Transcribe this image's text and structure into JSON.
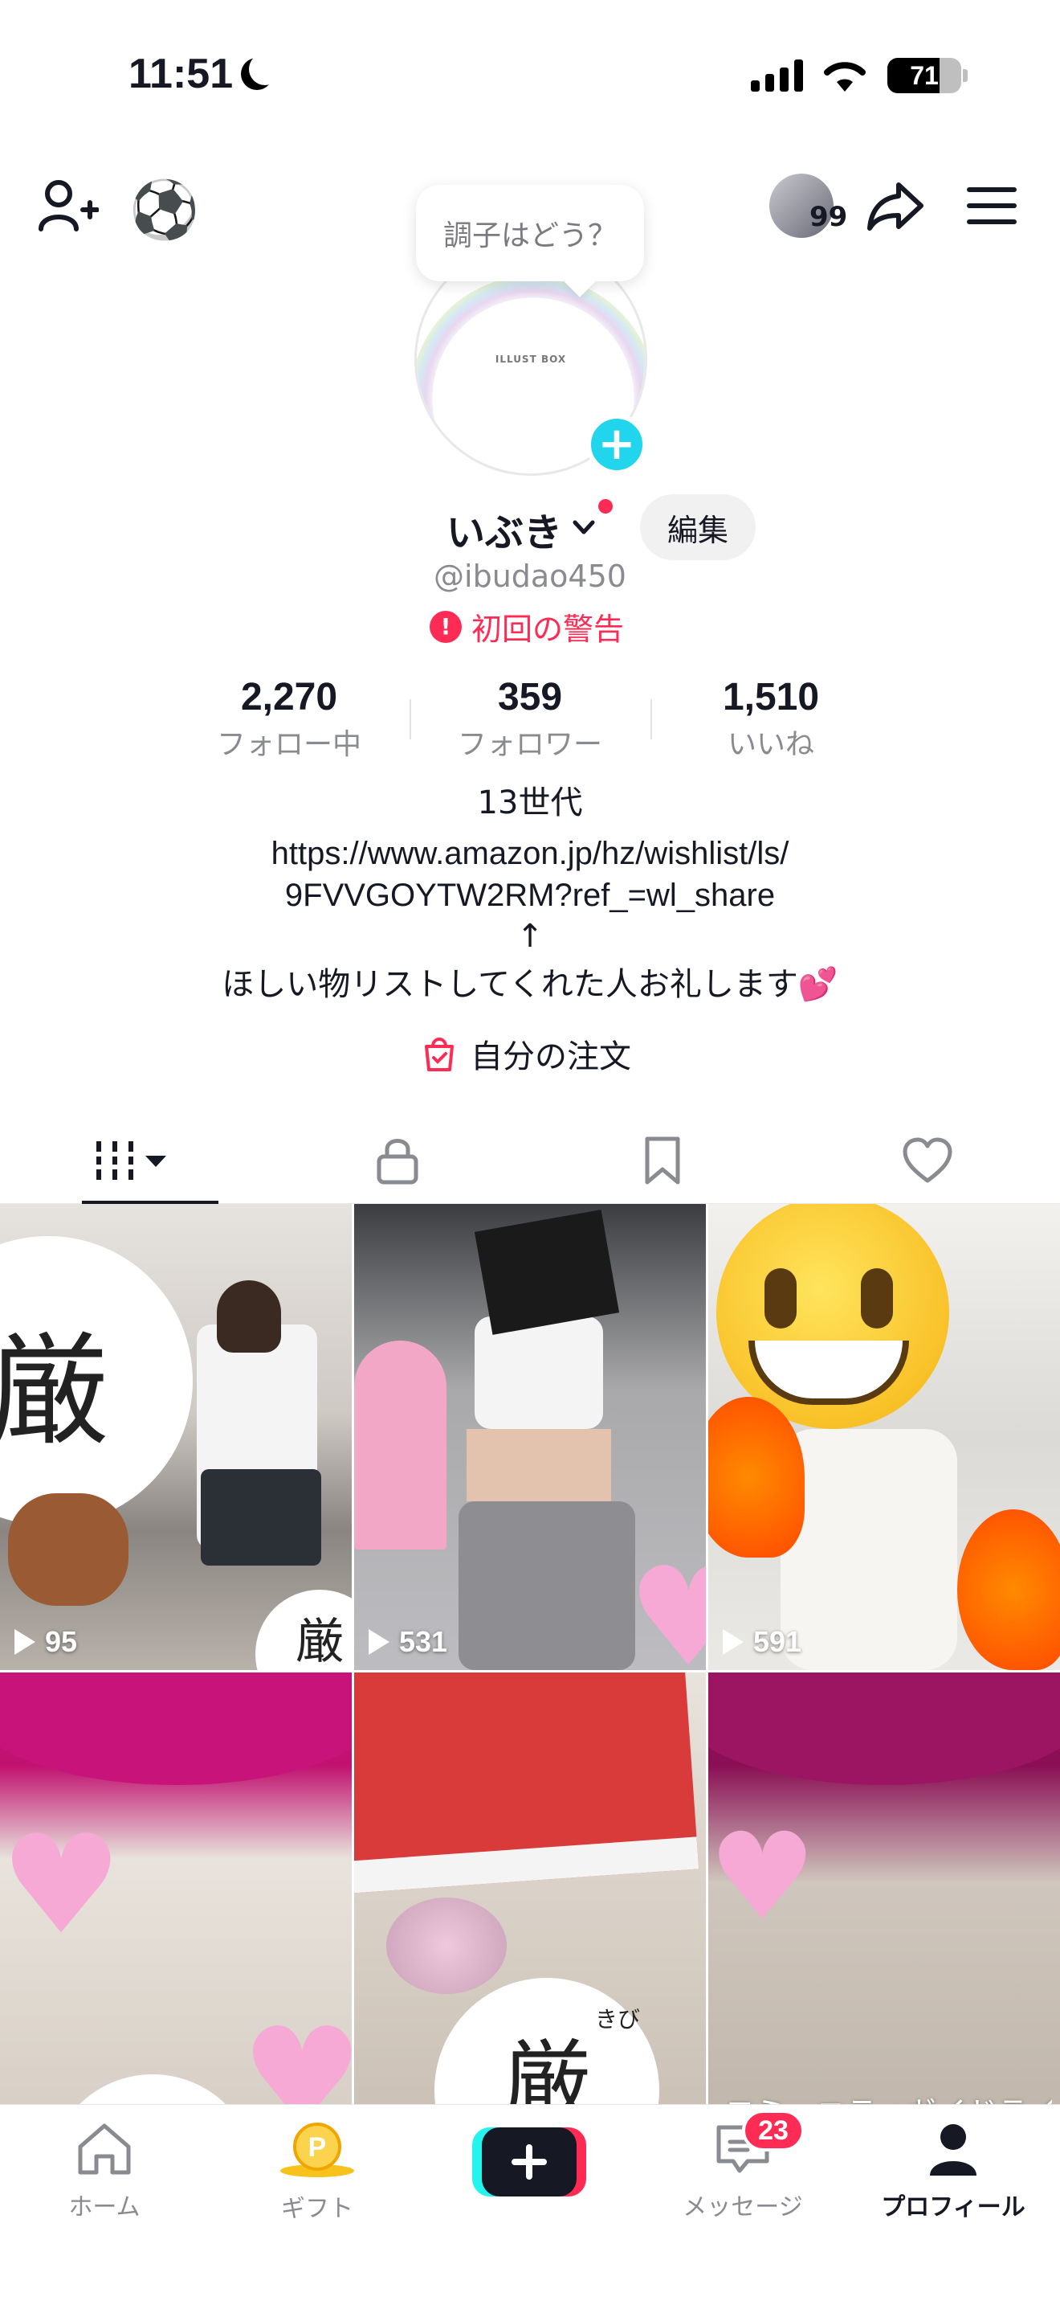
{
  "status": {
    "time": "11:51",
    "battery": "71",
    "battery_level": 0.71
  },
  "topnav": {
    "visitor_count": "99"
  },
  "profile": {
    "bubble": "調子はどう？",
    "avatar_brand": "ILLUST BOX",
    "nickname": "いぶき",
    "edit_label": "編集",
    "username": "@ibudao450",
    "warning": "初回の警告"
  },
  "stats": [
    {
      "value": "2,270",
      "label": "フォロー中"
    },
    {
      "value": "359",
      "label": "フォロワー"
    },
    {
      "value": "1,510",
      "label": "いいね"
    }
  ],
  "bio": {
    "line1": "13世代",
    "line2": "https://www.amazon.jp/hz/wishlist/ls/",
    "line3": "9FVVGOYTW2RM?ref_=wl_share",
    "line4": "↑",
    "line5": "ほしい物リストしてくれた人お礼します",
    "emoji": "💕"
  },
  "orders_label": "自分の注文",
  "videos": [
    {
      "views": "95"
    },
    {
      "views": "531"
    },
    {
      "views": "591"
    },
    {
      "views": ""
    },
    {
      "views": ""
    },
    {
      "caption": "コミュニティガイドライン違反"
    }
  ],
  "stamp_text": {
    "kanji": "厳",
    "kana": "きび"
  },
  "bottomnav": {
    "home": "ホーム",
    "gift": "ギフト",
    "messages": "メッセージ",
    "messages_badge": "23",
    "profile": "プロフィール"
  }
}
